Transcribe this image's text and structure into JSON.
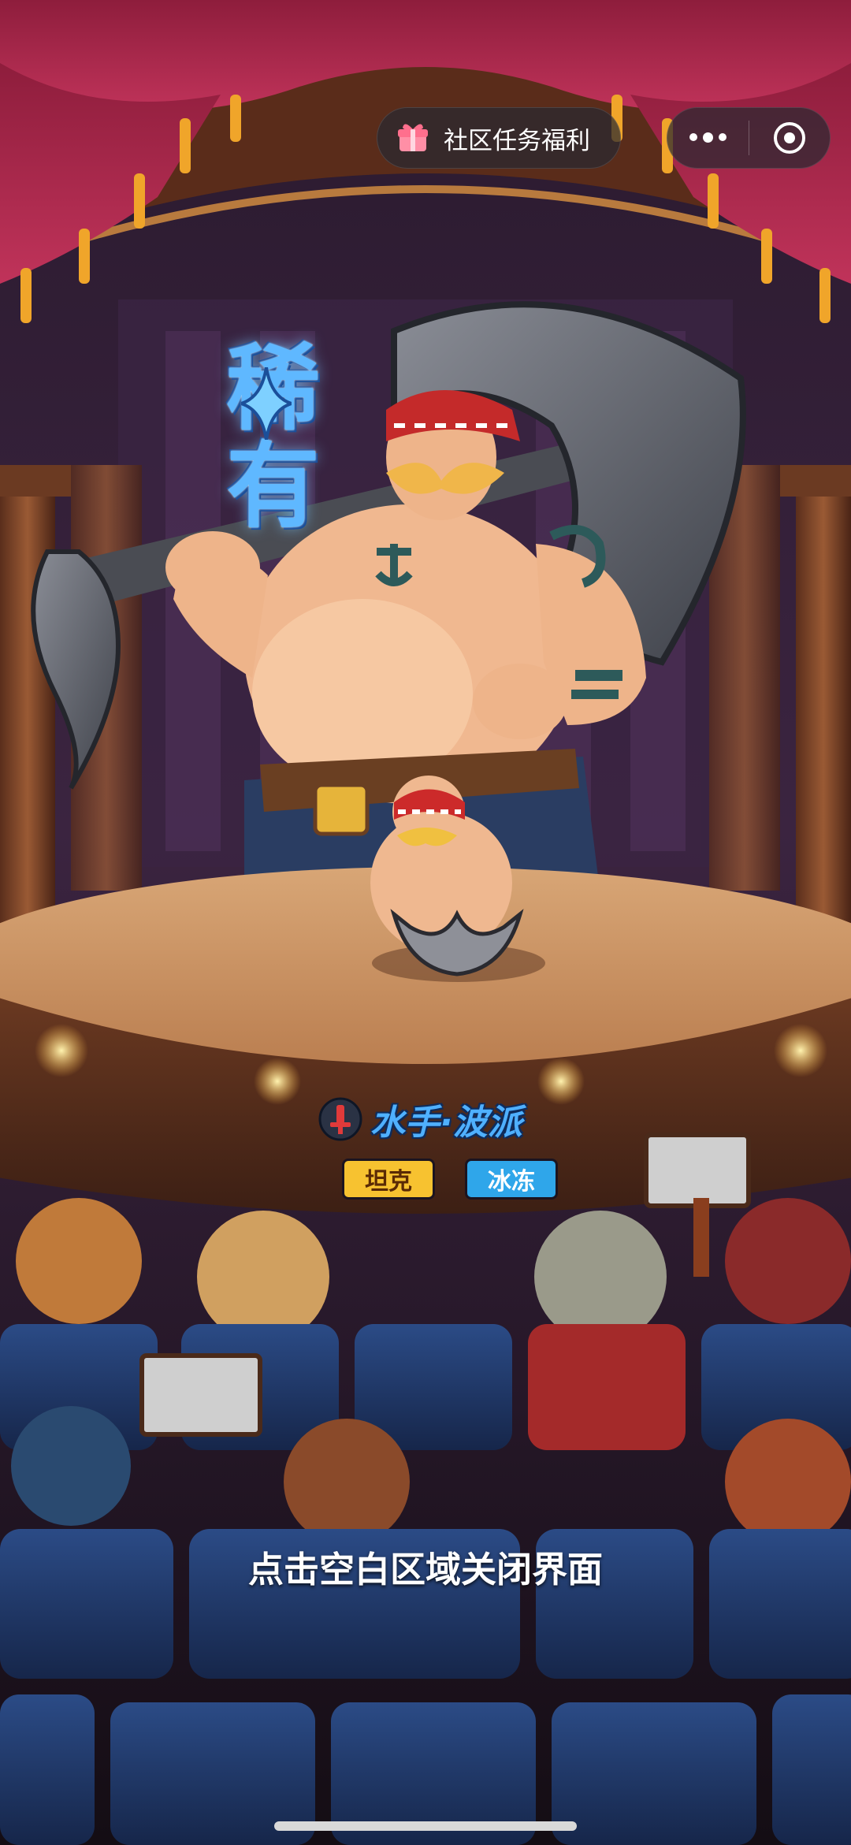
{
  "top_bar": {
    "community_label": "社区任务福利",
    "more_icon": "more-dots-icon",
    "close_icon": "target-circle-icon"
  },
  "hero": {
    "rarity": "稀有",
    "name": "水手·波派",
    "tags": [
      "坦克",
      "冰冻"
    ],
    "class_icon": "red-sword-emblem-icon"
  },
  "hint": "点击空白区域关闭界面",
  "colors": {
    "rarity_blue": "#5fb8ff",
    "name_blue": "#4fb0ff",
    "tank_tag": "#f7c230",
    "freeze_tag": "#2fa6ea"
  }
}
